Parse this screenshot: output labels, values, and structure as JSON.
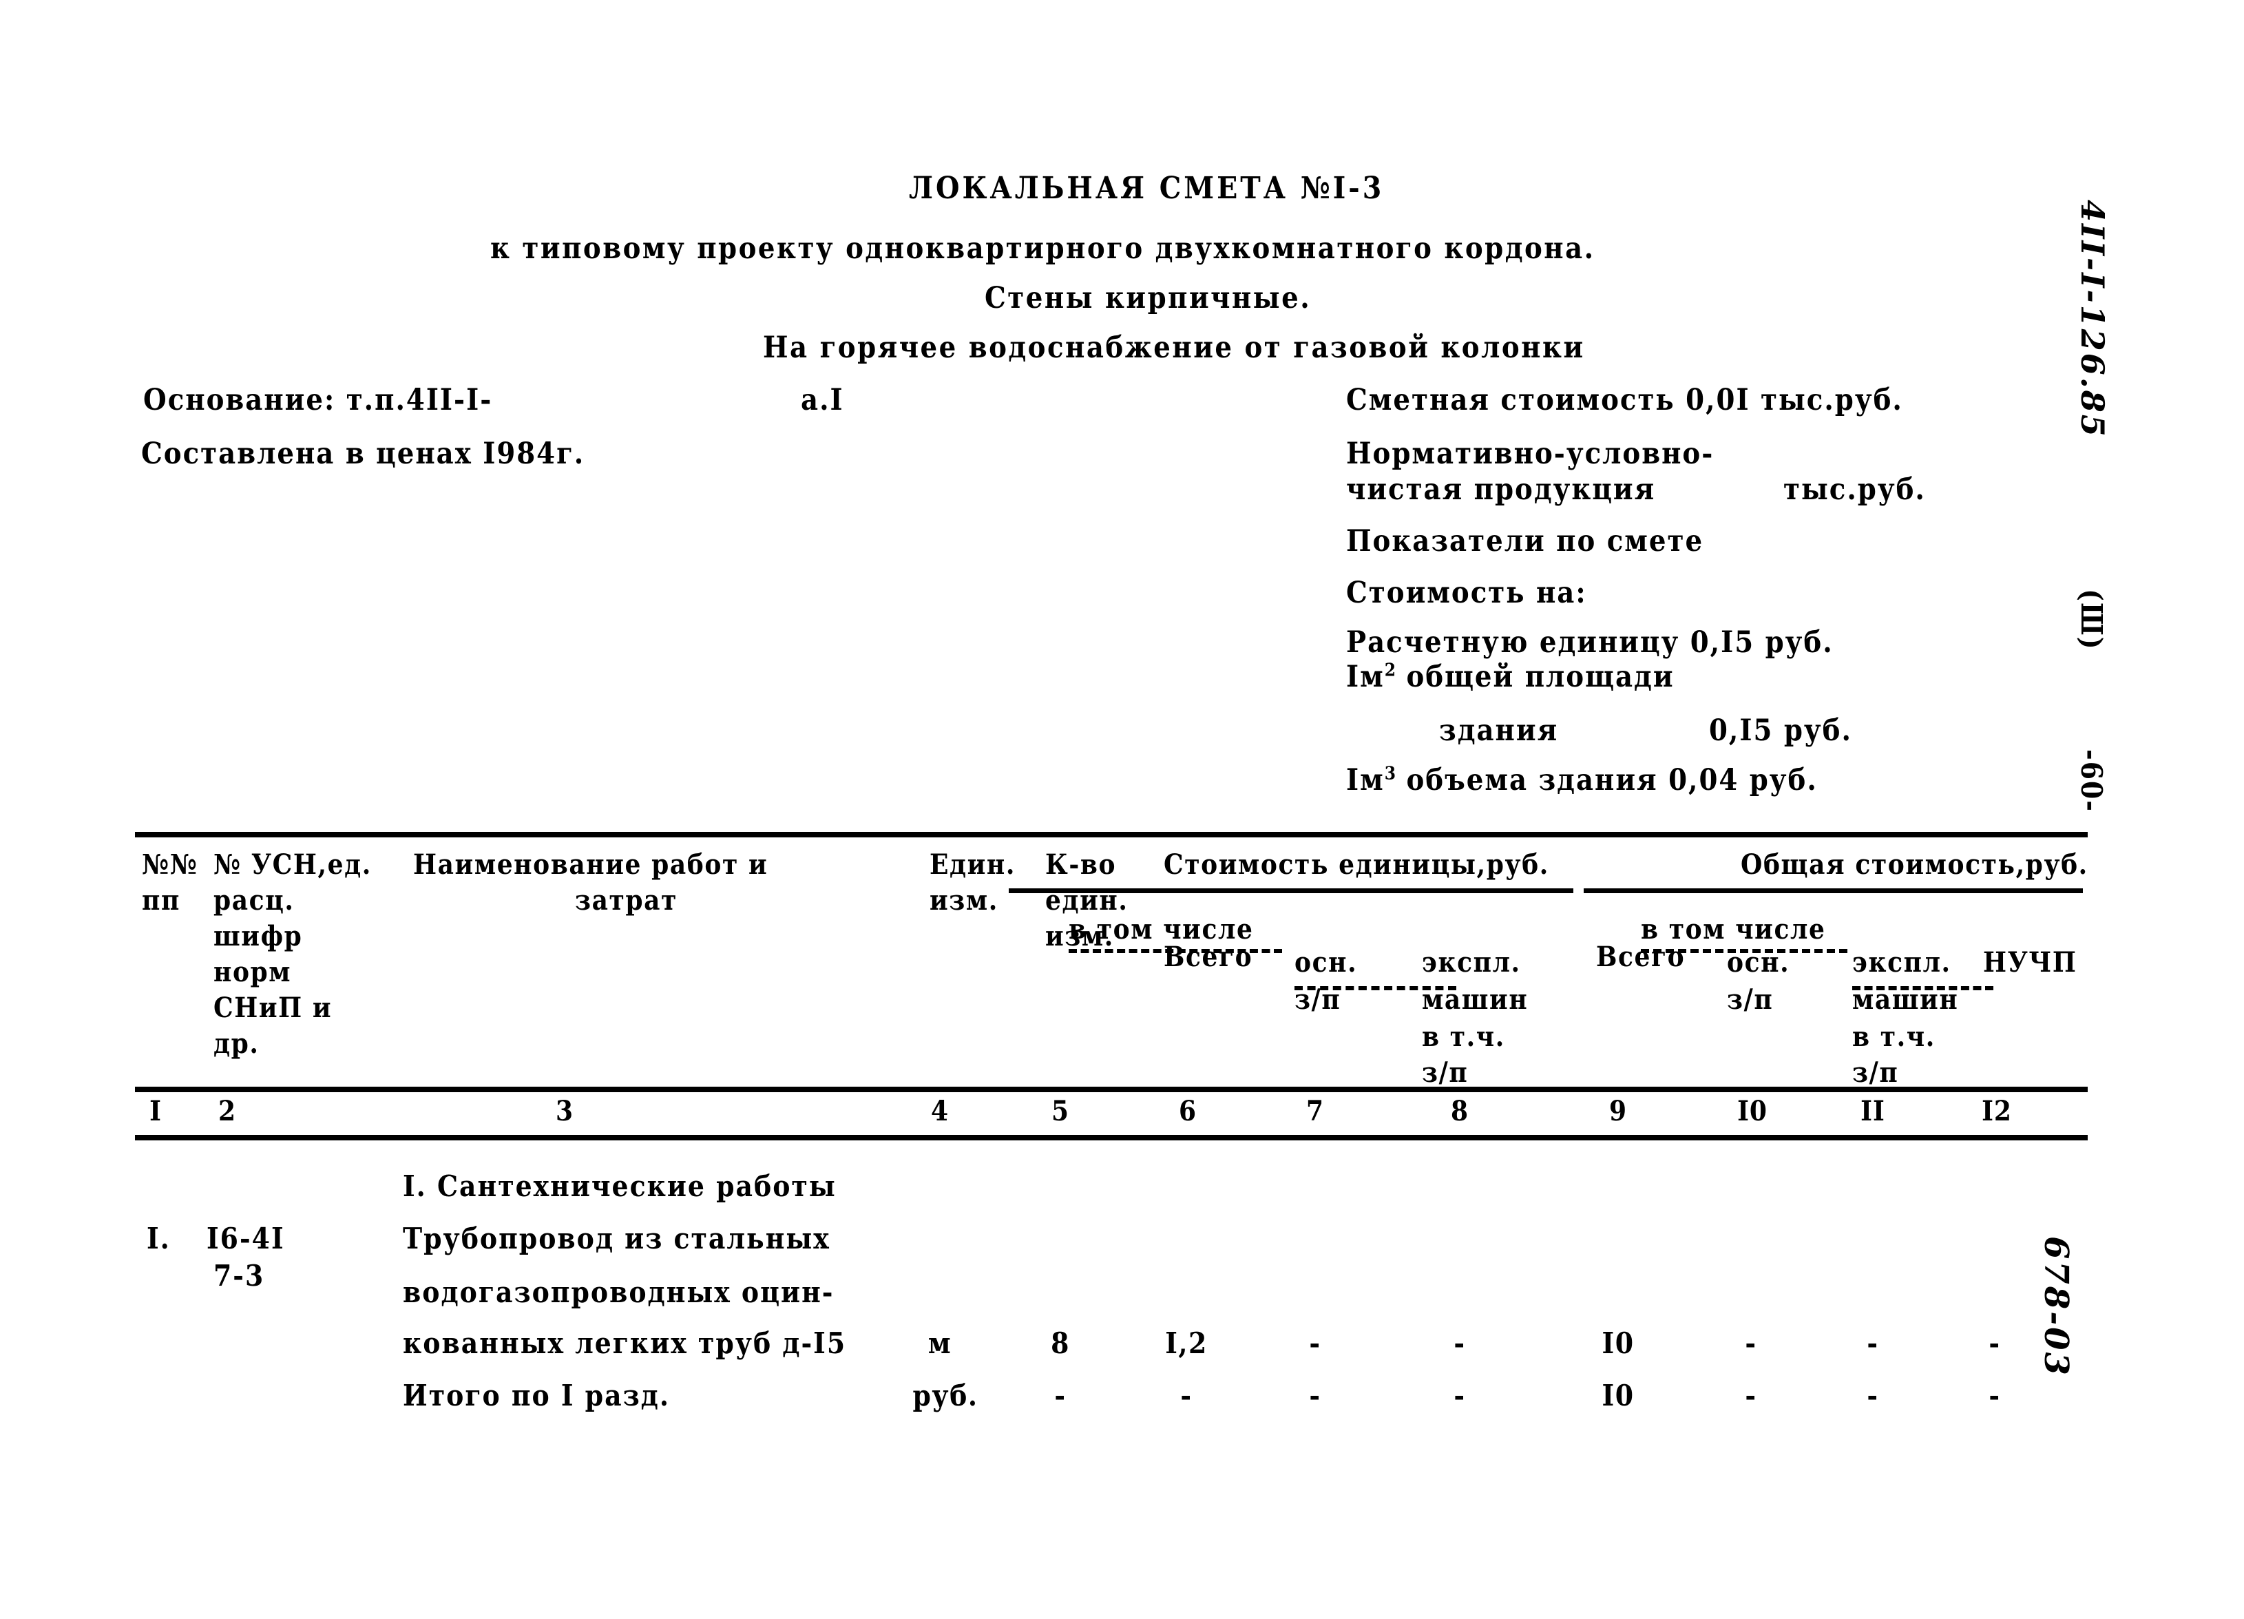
{
  "document": {
    "title": "ЛОКАЛЬНАЯ СМЕТА №I-3",
    "subtitle_1": "к типовому проекту одноквартирного двухкомнатного кордона.",
    "subtitle_2": "Стены кирпичные.",
    "subtitle_3": "На горячее водоснабжение от газовой колонки"
  },
  "meta_left": {
    "basis_label": "Основание: т.п.4II-I-",
    "basis_suffix": "а.I",
    "compiled": "Составлена в ценах I984г."
  },
  "meta_right": {
    "estimate_cost": "Сметная стоимость 0,0I тыс.руб.",
    "nucp_line1": "Нормативно-условно-",
    "nucp_line2": "чистая продукция",
    "nucp_unit": "тыс.руб.",
    "indicators": "Показатели по смете",
    "cost_for": "Стоимость на:",
    "calc_unit": "Расчетную единицу 0,I5 руб.",
    "m2_area_pre": "Iм",
    "m2_area_sup": "2",
    "m2_area_post": " общей площади",
    "building_word": "здания",
    "building_value": "0,I5 руб.",
    "m3_vol_pre": "Iм",
    "m3_vol_sup": "3",
    "m3_vol_post": " объема здания 0,04 руб."
  },
  "table": {
    "headers": {
      "no_line1": "№№",
      "no_line2": "пп",
      "usn_line1": "№ УСН,ед.",
      "usn_line2": "расц.",
      "usn_line3": "шифр",
      "usn_line4": "норм",
      "usn_line5": "СНиП и",
      "usn_line6": "др.",
      "name_line1": "Наименование работ и",
      "name_line2": "затрат",
      "unit_line1": "Един.",
      "unit_line2": "изм.",
      "qty_line1": "К-во",
      "qty_line2": "един.",
      "qty_line3": "изм.",
      "unit_cost_group": "Стоимость единицы,руб.",
      "total_cost_group": "Общая стоимость,руб.",
      "vsego": "Всего",
      "v_tom_chisle": "в том числе",
      "osn": "осн.",
      "zp": "з/п",
      "ekspl": "экспл.",
      "mashin": "машин",
      "v_t_ch": "в т.ч.",
      "zp2": "з/п",
      "nuchp": "НУЧП"
    },
    "column_numbers": [
      "I",
      "2",
      "3",
      "4",
      "5",
      "6",
      "7",
      "8",
      "9",
      "I0",
      "II",
      "I2"
    ],
    "section_title": "I. Сантехнические работы",
    "rows": [
      {
        "no": "I.",
        "code_line1": "I6-4I",
        "code_line2": "7-3",
        "name_line1": "Трубопровод из стальных",
        "name_line2": "водогазопроводных оцин-",
        "name_line3": "кованных легких труб д-I5",
        "unit": "м",
        "qty": "8",
        "unit_total": "I,2",
        "unit_osn_zp": "-",
        "unit_ekspl": "-",
        "total": "I0",
        "total_osn_zp": "-",
        "total_ekspl": "-",
        "total_nuchp": "-"
      },
      {
        "no": "",
        "code_line1": "",
        "code_line2": "",
        "name_line1": "Итого по I разд.",
        "name_line2": "",
        "name_line3": "",
        "unit": "руб.",
        "qty": "-",
        "unit_total": "-",
        "unit_osn_zp": "-",
        "unit_ekspl": "-",
        "total": "I0",
        "total_osn_zp": "-",
        "total_ekspl": "-",
        "total_nuchp": "-"
      }
    ]
  },
  "margin_stamps": {
    "code": "4II-I-126.85",
    "roman": "(Ш)",
    "page": "-60-",
    "doc_number": "678-03"
  }
}
